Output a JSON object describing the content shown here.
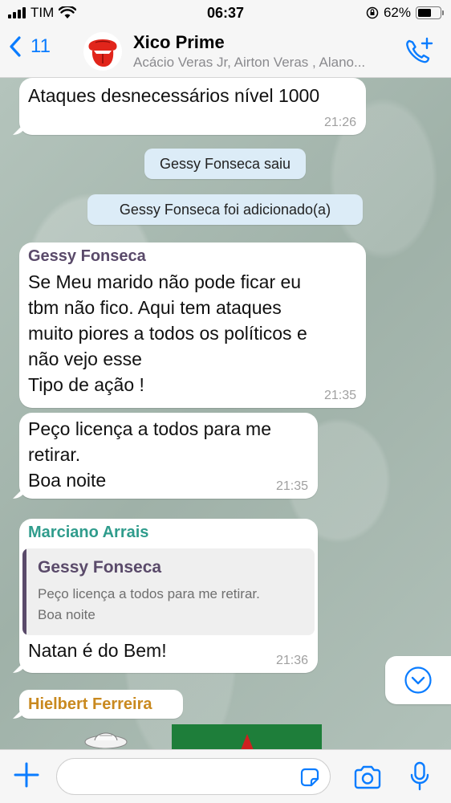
{
  "status_bar": {
    "carrier": "TIM",
    "time": "06:37",
    "battery_percent": "62%",
    "battery_level": 0.62
  },
  "header": {
    "back_count": "11",
    "group_name": "Xico Prime",
    "members": "Acácio Veras Jr, Airton Veras , Alano..."
  },
  "messages": [
    {
      "text": "Ataques desnecessários nível 1000",
      "time": "21:26"
    },
    {
      "system": "Gessy Fonseca saiu"
    },
    {
      "system": "Gessy Fonseca foi adicionado(a)"
    },
    {
      "sender": "Gessy Fonseca",
      "sender_color": "#5a4a6a",
      "lines": [
        "Se Meu marido não pode ficar eu",
        "tbm não fico. Aqui tem ataques",
        "muito piores a todos os políticos e",
        "não vejo esse",
        "Tipo de ação !"
      ],
      "time": "21:35"
    },
    {
      "lines": [
        "Peço licença a todos para me",
        "retirar.",
        "Boa noite"
      ],
      "time": "21:35"
    },
    {
      "sender": "Marciano Arrais",
      "sender_color": "#2f9c8c",
      "quote_name": "Gessy Fonseca",
      "quote_lines": [
        "Peço licença a todos para me retirar.",
        "Boa noite"
      ],
      "text": "Natan é do Bem!",
      "time": "21:36"
    },
    {
      "sender": "Hielbert Ferreira",
      "sender_color": "#c9891f"
    }
  ],
  "input": {
    "placeholder": ""
  },
  "colors": {
    "ios_blue": "#0a7cff",
    "system_bubble": "#dcecf7",
    "wallpaper": "#a9bab2"
  },
  "icons": [
    "back-chevron-icon",
    "rolling-stones-tongue-icon",
    "add-call-icon",
    "chevron-down-circle-icon",
    "plus-icon",
    "sticker-icon",
    "camera-icon",
    "microphone-icon"
  ]
}
